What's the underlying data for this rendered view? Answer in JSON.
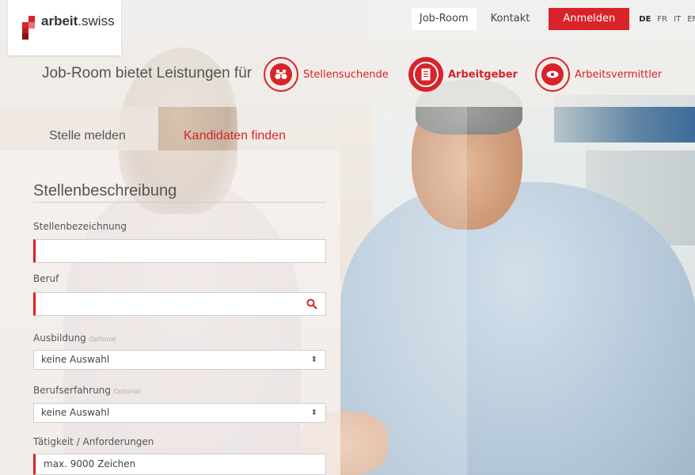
{
  "brand": {
    "prefix": "arbeit",
    "suffix": ".swiss"
  },
  "nav": {
    "job_room": "Job-Room",
    "kontakt": "Kontakt",
    "login": "Anmelden",
    "languages": [
      "DE",
      "FR",
      "IT",
      "EN"
    ],
    "selected_language": "DE"
  },
  "services": {
    "title": "Job-Room bietet Leistungen für",
    "items": [
      {
        "label": "Stellensuchende",
        "icon": "binoculars-icon",
        "active": false
      },
      {
        "label": "Arbeitgeber",
        "icon": "document-icon",
        "active": true
      },
      {
        "label": "Arbeitsvermittler",
        "icon": "eye-icon",
        "active": false
      }
    ]
  },
  "tabs": {
    "report_job": "Stelle melden",
    "find_candidates": "Kandidaten finden"
  },
  "form": {
    "section_title": "Stellenbeschreibung",
    "job_title_label": "Stellenbezeichnung",
    "job_title_value": "",
    "occupation_label": "Beruf",
    "occupation_value": "",
    "education_label": "Ausbildung",
    "education_optional": "Optional",
    "education_value": "keine Auswahl",
    "experience_label": "Berufserfahrung",
    "experience_optional": "Optional",
    "experience_value": "keine Auswahl",
    "activity_label": "Tätigkeit / Anforderungen",
    "activity_placeholder": "max. 9000 Zeichen"
  },
  "colors": {
    "accent": "#d8232a"
  }
}
